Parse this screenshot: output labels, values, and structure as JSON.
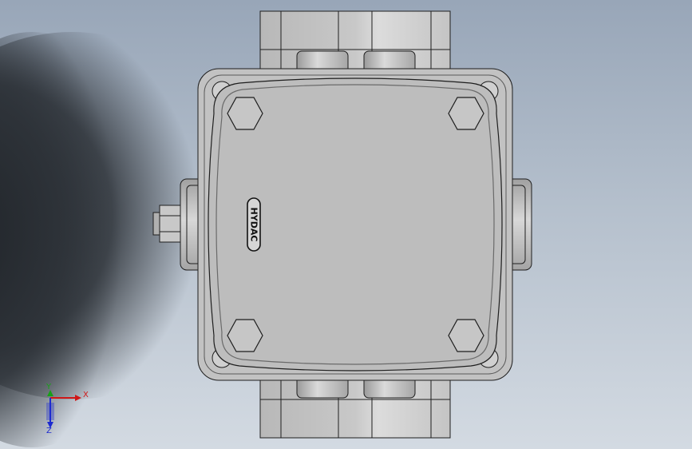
{
  "model": {
    "logo_text": "HYDAC"
  },
  "triad": {
    "x_label": "X",
    "y_label": "Y",
    "z_label": "Z",
    "colors": {
      "x": "#d01818",
      "y": "#18a018",
      "z": "#1c2ad0"
    }
  },
  "colors": {
    "part_fill": "#bcbcbc",
    "part_edge": "#1e1e1e",
    "shadow": "#22262b"
  }
}
